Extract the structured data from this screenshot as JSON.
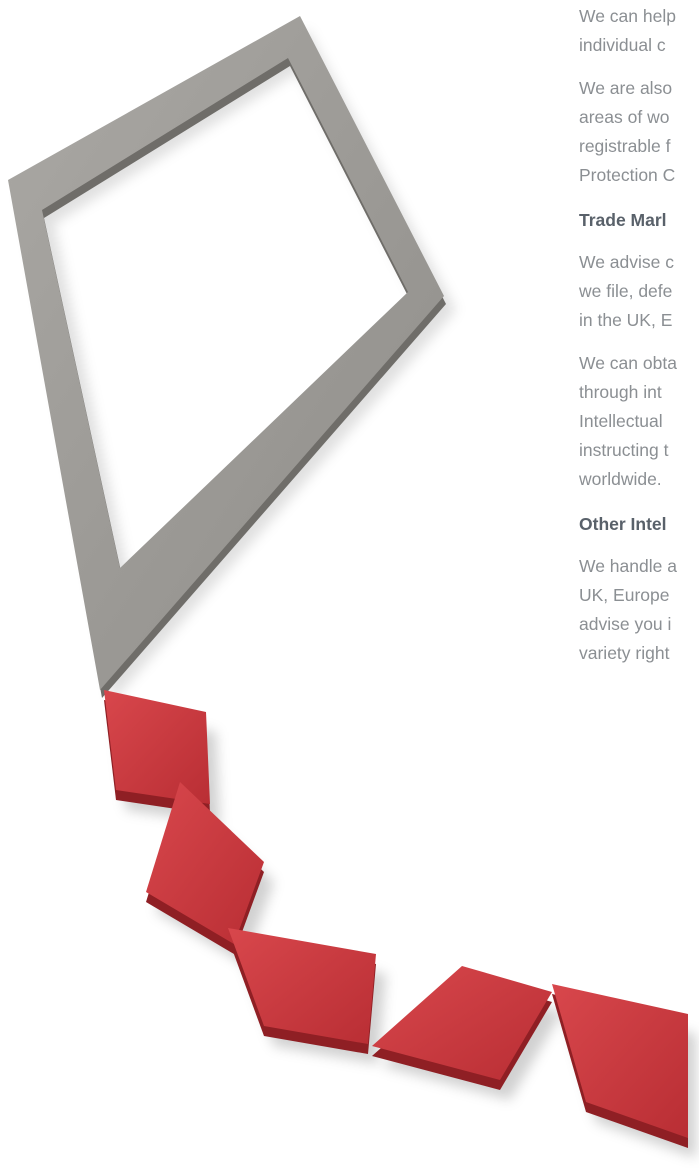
{
  "page": {
    "paragraph_1": [
      "We can help",
      "individual c"
    ],
    "paragraph_2": [
      "We are also",
      "areas of wo",
      "registrable f",
      "Protection C"
    ],
    "heading_trade_marks": "Trade Marl",
    "paragraph_3": [
      "We advise c",
      "we file, defe",
      "in the UK, E"
    ],
    "paragraph_4": [
      "We can obta",
      "through int",
      "Intellectual",
      "instructing t",
      "worldwide."
    ],
    "heading_other": "Other Intel",
    "paragraph_5": [
      "We handle a",
      "UK, Europe",
      "advise you i",
      "variety right"
    ]
  },
  "colors": {
    "body_text": "#8b8f93",
    "heading_text": "#59616a",
    "kite_frame": "#9a9894",
    "kite_tail": "#c8353b"
  }
}
